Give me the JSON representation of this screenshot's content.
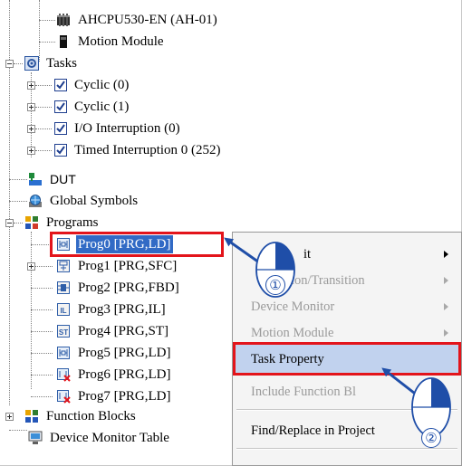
{
  "tree": {
    "items": [
      {
        "label": "AHCPU530-EN (AH-01)",
        "icon": "cpu-icon"
      },
      {
        "label": "Motion Module",
        "icon": "module-icon"
      },
      {
        "label": "Tasks",
        "icon": "tasks-icon"
      },
      {
        "label": "Cyclic (0)",
        "icon": "checkbox-icon"
      },
      {
        "label": "Cyclic (1)",
        "icon": "checkbox-icon"
      },
      {
        "label": "I/O Interruption (0)",
        "icon": "checkbox-icon"
      },
      {
        "label": "Timed Interruption 0 (252)",
        "icon": "checkbox-icon"
      },
      {
        "label": "DUT",
        "icon": "dut-icon"
      },
      {
        "label": "Global Symbols",
        "icon": "globe-icon"
      },
      {
        "label": "Programs",
        "icon": "programs-icon"
      },
      {
        "label": "Prog0 [PRG,LD]",
        "icon": "ld-icon"
      },
      {
        "label": "Prog1 [PRG,SFC]",
        "icon": "sfc-icon"
      },
      {
        "label": "Prog2 [PRG,FBD]",
        "icon": "fbd-icon"
      },
      {
        "label": "Prog3 [PRG,IL]",
        "icon": "il-icon"
      },
      {
        "label": "Prog4 [PRG,ST]",
        "icon": "st-icon"
      },
      {
        "label": "Prog5 [PRG,LD]",
        "icon": "ld-icon"
      },
      {
        "label": "Prog6 [PRG,LD]",
        "icon": "ld-disabled-icon"
      },
      {
        "label": "Prog7 [PRG,LD]",
        "icon": "ld-disabled-icon"
      },
      {
        "label": "Function Blocks",
        "icon": "function-blocks-icon"
      },
      {
        "label": "Device Monitor Table",
        "icon": "monitor-icon"
      }
    ],
    "icon_text": {
      "il": "IL",
      "st": "ST"
    }
  },
  "context_menu": {
    "items": [
      {
        "label": "Edit",
        "visible_text": "it",
        "enabled": true,
        "submenu": true
      },
      {
        "label": "Action/Transition",
        "visible_text": "ion/Transition",
        "enabled": false,
        "submenu": true
      },
      {
        "label": "Device Monitor",
        "enabled": false,
        "submenu": true
      },
      {
        "label": "Motion Module",
        "enabled": false,
        "submenu": true
      },
      {
        "label": "Task Property",
        "enabled": true,
        "submenu": false,
        "highlighted": true
      },
      {
        "label": "Include Function Blocks",
        "visible_text": "Include Function Bl",
        "enabled": false,
        "submenu": false
      },
      {
        "label": "Find/Replace in Project",
        "enabled": true,
        "submenu": false
      }
    ]
  },
  "callouts": [
    {
      "number": "①"
    },
    {
      "number": "②"
    }
  ],
  "colors": {
    "selection_blue": "#316ac5",
    "annotation_red": "#e3141b",
    "callout_blue": "#1f4ea8",
    "menu_highlight": "#c1d2ee"
  }
}
